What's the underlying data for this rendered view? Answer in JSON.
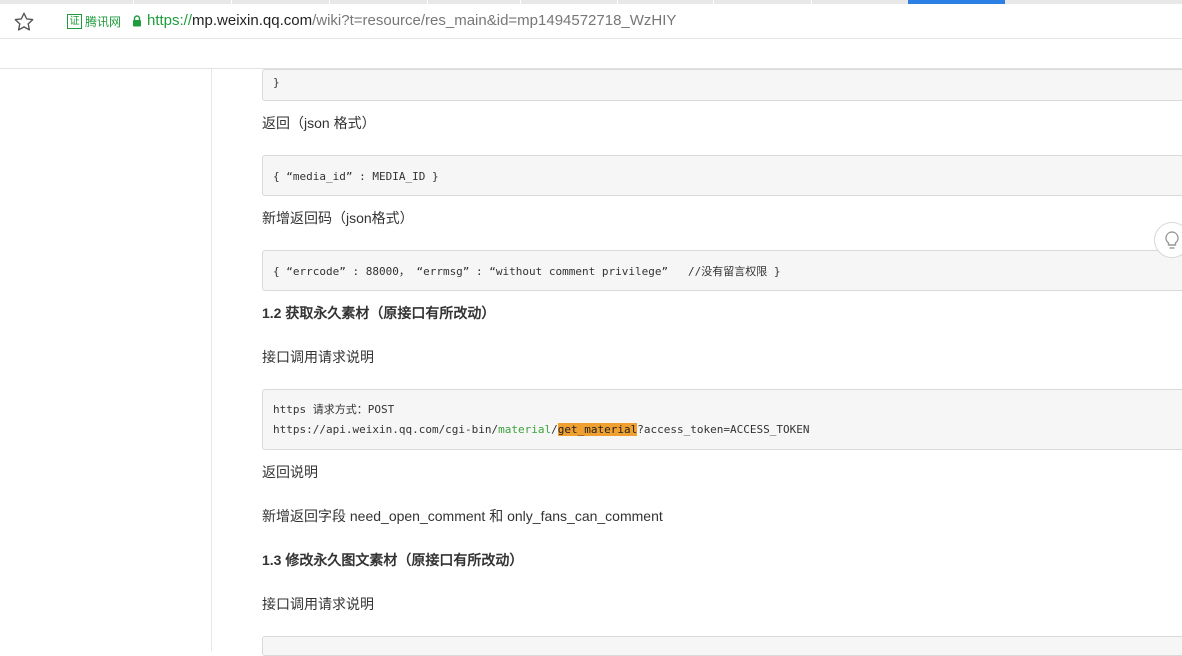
{
  "browser": {
    "cert_box": "证",
    "cert_label": "腾讯网",
    "url_scheme": "https://",
    "url_host": "mp.weixin.qq.com",
    "url_path": "/wiki?t=resource/res_main&id=mp1494572718_WzHIY",
    "icons": [
      "star-icon",
      "lock-icon",
      "lightbulb-icon"
    ]
  },
  "article": {
    "code_close": "}",
    "return_json_label": "返回（json 格式）",
    "code_media_id": "{ “media_id” : MEDIA_ID }",
    "new_return_code_label": "新增返回码（json格式）",
    "code_errcode": "{ “errcode” : 88000， “errmsg” : “without comment privilege”   //没有留言权限 }",
    "section_1_2": "1.2 获取永久素材（原接口有所改动）",
    "request_desc_1": "接口调用请求说明",
    "code_req_line1": "https 请求方式：POST",
    "code_req_url_prefix": "https://api.weixin.qq.com/cgi-bin/",
    "code_req_url_material": "material",
    "code_req_url_slash": "/",
    "code_req_url_get": "get_material",
    "code_req_url_suffix": "?access_token=ACCESS_TOKEN",
    "return_desc": "返回说明",
    "new_fields": "新增返回字段 need_open_comment 和 only_fans_can_comment",
    "section_1_3": "1.3 修改永久图文素材（原接口有所改动）",
    "request_desc_2": "接口调用请求说明"
  }
}
